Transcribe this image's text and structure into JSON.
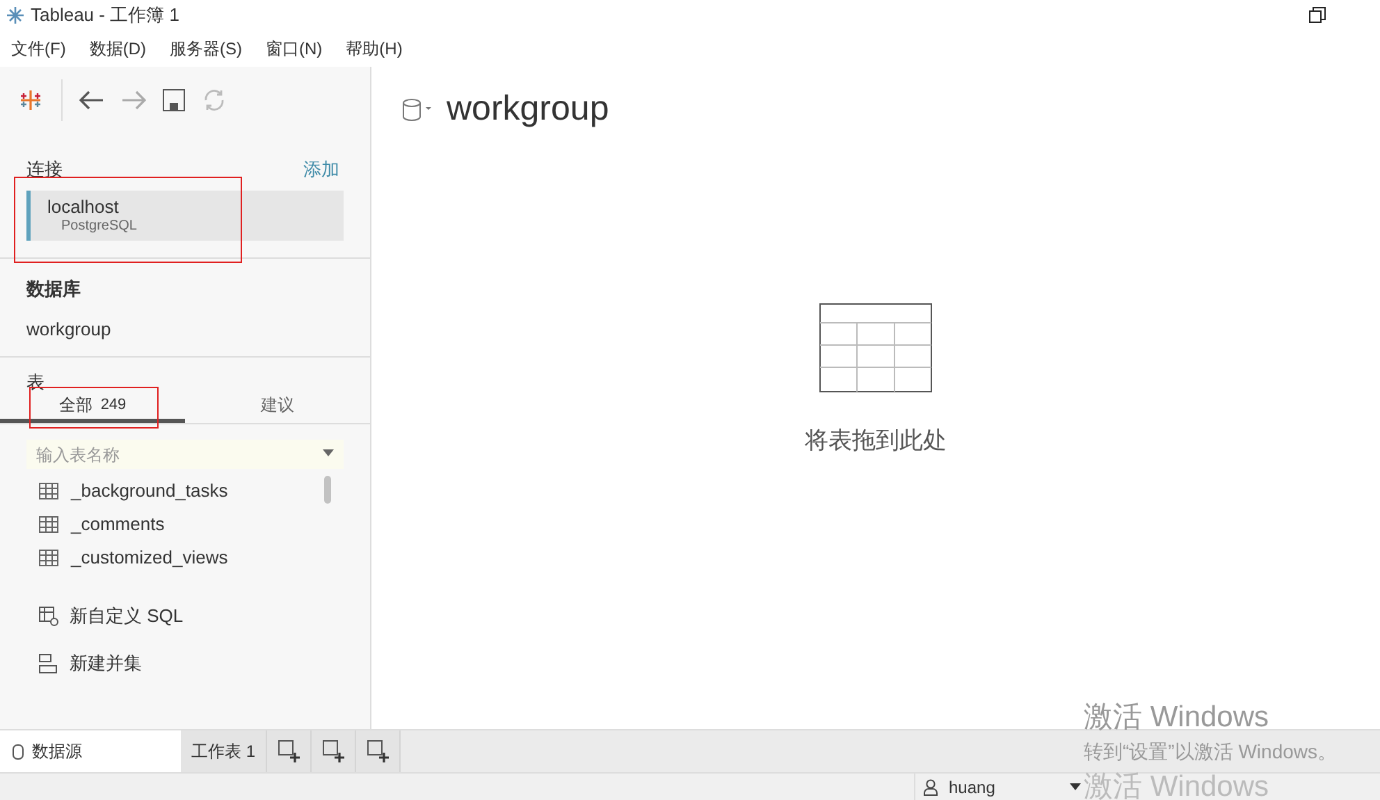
{
  "window": {
    "title": "Tableau - 工作簿 1"
  },
  "menu": [
    "文件(F)",
    "数据(D)",
    "服务器(S)",
    "窗口(N)",
    "帮助(H)"
  ],
  "connections": {
    "heading": "连接",
    "add": "添加",
    "items": [
      {
        "name": "localhost",
        "type": "PostgreSQL",
        "selected": true
      }
    ]
  },
  "database": {
    "heading": "数据库",
    "value": "workgroup"
  },
  "tables": {
    "heading": "表",
    "tabs": [
      {
        "label": "全部",
        "count": "249",
        "selected": true
      },
      {
        "label": "建议",
        "selected": false
      }
    ],
    "search": {
      "placeholder": "输入表名称"
    },
    "items": [
      "_background_tasks",
      "_comments",
      "_customized_views"
    ],
    "actions": [
      {
        "kind": "sql",
        "label": "新自定义 SQL"
      },
      {
        "kind": "union",
        "label": "新建并集"
      }
    ]
  },
  "canvas": {
    "title": "workgroup",
    "drop_hint": "将表拖到此处"
  },
  "sheet_tabs": [
    {
      "label": "数据源",
      "selected": true
    },
    {
      "label": "工作表 1",
      "selected": false
    }
  ],
  "status_bar": {
    "user": "huang"
  },
  "activation": {
    "title": "激活 Windows",
    "message": "转到“设置”以激活 Windows。",
    "repeat": "激活 Windows"
  }
}
